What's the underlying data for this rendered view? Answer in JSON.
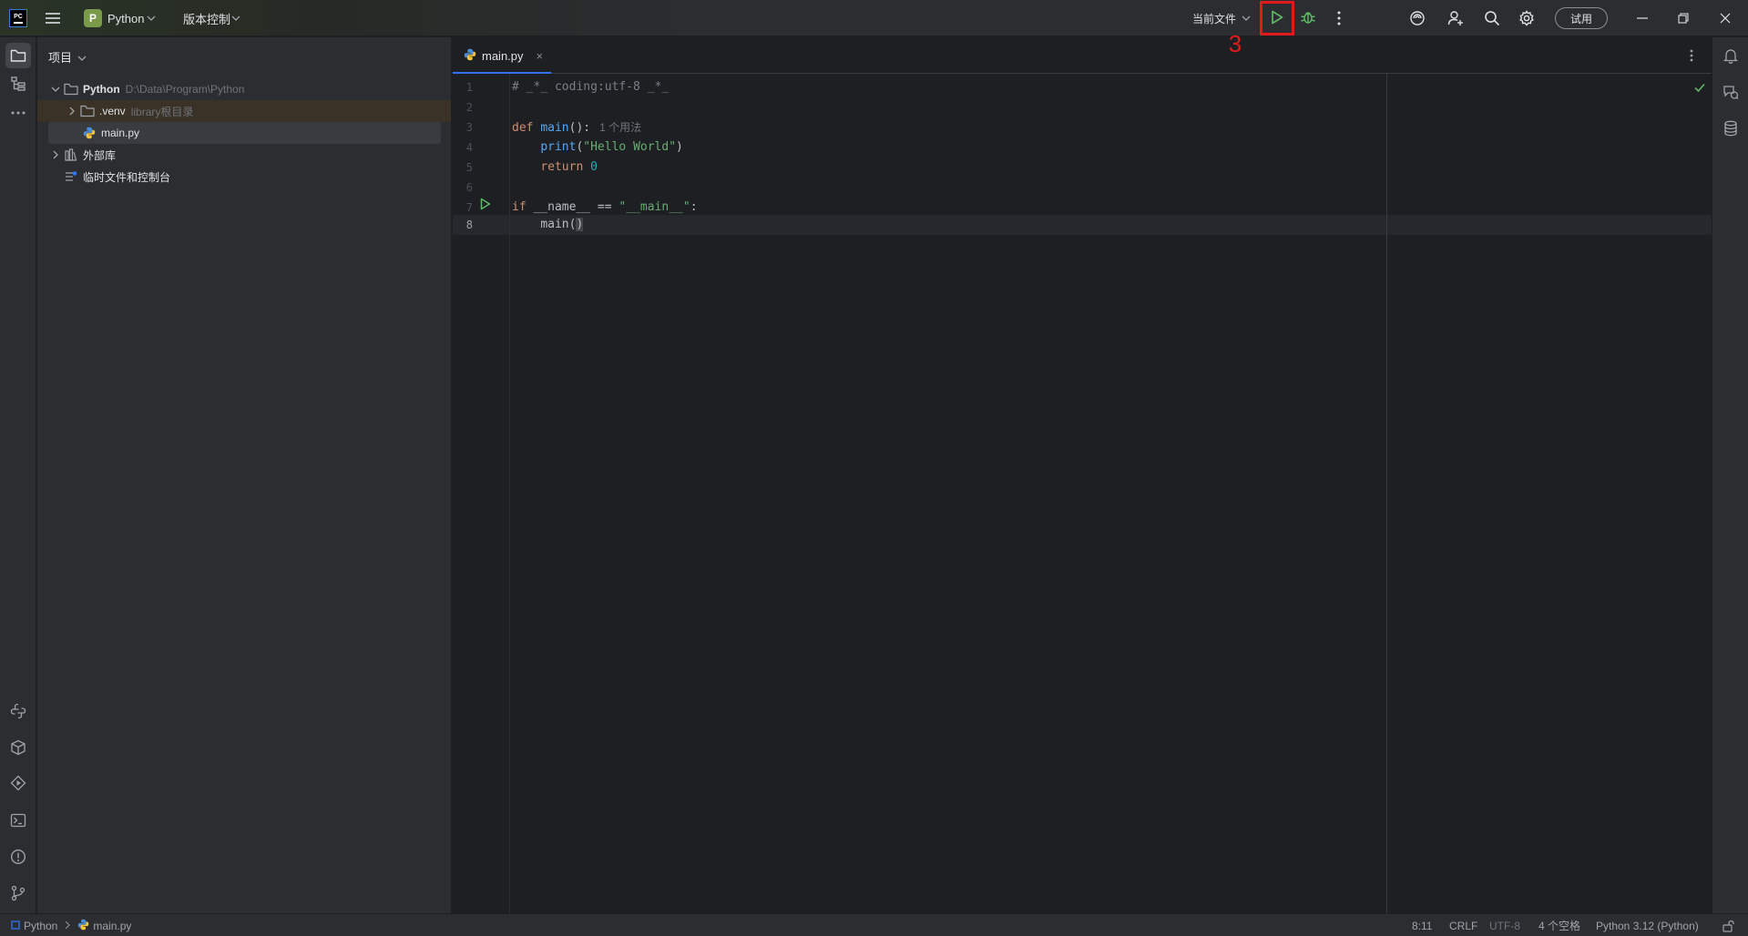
{
  "titlebar": {
    "app_logo_text": "PC",
    "project_badge": "P",
    "project_name": "Python",
    "vcs_label": "版本控制",
    "run_config": "当前文件",
    "trial_label": "试用",
    "annotation": "3"
  },
  "sidebar": {
    "title": "项目",
    "tree": [
      {
        "label": "Python",
        "hint": "D:\\Data\\Program\\Python"
      },
      {
        "label": ".venv",
        "hint": "library根目录"
      },
      {
        "label": "main.py",
        "hint": ""
      },
      {
        "label": "外部库",
        "hint": ""
      },
      {
        "label": "临时文件和控制台",
        "hint": ""
      }
    ]
  },
  "editor": {
    "tab_label": "main.py",
    "close_glyph": "×",
    "lines": [
      {
        "n": "1"
      },
      {
        "n": "2"
      },
      {
        "n": "3"
      },
      {
        "n": "4"
      },
      {
        "n": "5"
      },
      {
        "n": "6"
      },
      {
        "n": "7"
      },
      {
        "n": "8"
      }
    ],
    "code": {
      "l1_comment": "# _*_ coding:utf-8 _*_",
      "l3_def": "def",
      "l3_fn": "main",
      "l3_rest": "():",
      "l3_hint": "1 个用法",
      "l4_indent": "    ",
      "l4_fn": "print",
      "l4_open": "(",
      "l4_str": "\"Hello World\"",
      "l4_close": ")",
      "l5_indent": "    ",
      "l5_kw": "return",
      "l5_num": "0",
      "l7_kw": "if",
      "l7_mid": " __name__ == ",
      "l7_str": "\"__main__\"",
      "l7_end": ":",
      "l8_indent": "    ",
      "l8_call": "main(",
      "l8_close": ")"
    }
  },
  "statusbar": {
    "crumb_project": "Python",
    "crumb_file": "main.py",
    "position": "8:11",
    "line_sep": "CRLF",
    "encoding": "UTF-8",
    "indent": "4 个空格",
    "interpreter": "Python 3.12 (Python)"
  },
  "colors": {
    "accent": "#3574f0",
    "run_green": "#5fb865",
    "annotation_red": "#e01b1b"
  }
}
